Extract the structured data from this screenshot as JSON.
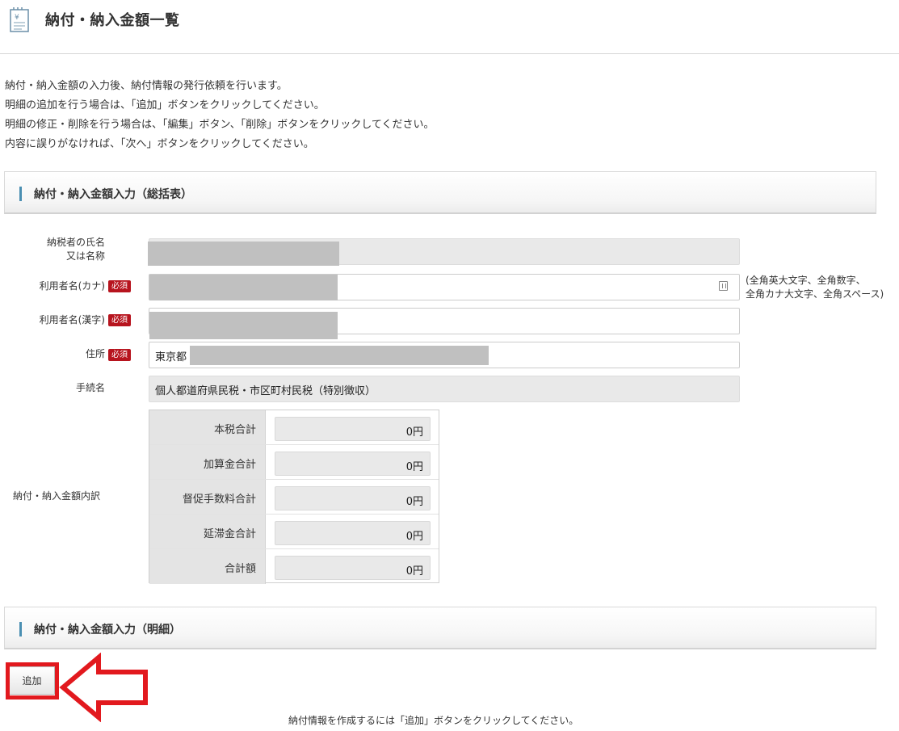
{
  "header": {
    "title": "納付・納入金額一覧",
    "icon": "yen-document-icon"
  },
  "intro": {
    "lines": [
      "納付・納入金額の入力後、納付情報の発行依頼を行います。",
      "明細の追加を行う場合は、「追加」ボタンをクリックしてください。",
      "明細の修正・削除を行う場合は、「編集」ボタン、「削除」ボタンをクリックしてください。",
      "内容に誤りがなければ、「次へ」ボタンをクリックしてください。"
    ]
  },
  "summary_section": {
    "title": "納付・納入金額入力（総括表）"
  },
  "detail_section": {
    "title": "納付・納入金額入力（明細）"
  },
  "form": {
    "taxpayer_name": {
      "label_line1": "納税者の氏名",
      "label_line2": "又は名称"
    },
    "user_kana": {
      "label": "利用者名(カナ)",
      "required": "必須",
      "hint_line1": "(全角英大文字、全角数字、",
      "hint_line2": "全角カナ大文字、全角スペース)"
    },
    "user_kanji": {
      "label": "利用者名(漢字)",
      "required": "必須"
    },
    "address": {
      "label": "住所",
      "required": "必須",
      "value": "東京都"
    },
    "procedure": {
      "label": "手続名",
      "value": "個人都道府県民税・市区町村民税（特別徴収）"
    }
  },
  "breakdown": {
    "label": "納付・納入金額内訳",
    "rows": [
      {
        "label": "本税合計",
        "value": "0円"
      },
      {
        "label": "加算金合計",
        "value": "0円"
      },
      {
        "label": "督促手数料合計",
        "value": "0円"
      },
      {
        "label": "延滞金合計",
        "value": "0円"
      },
      {
        "label": "合計額",
        "value": "0円"
      }
    ]
  },
  "add_button": {
    "label": "追加"
  },
  "footer_note": "納付情報を作成するには「追加」ボタンをクリックしてください。",
  "colors": {
    "required_badge": "#b7141e",
    "highlight": "#e2191e",
    "accent": "#4a8fb2"
  }
}
